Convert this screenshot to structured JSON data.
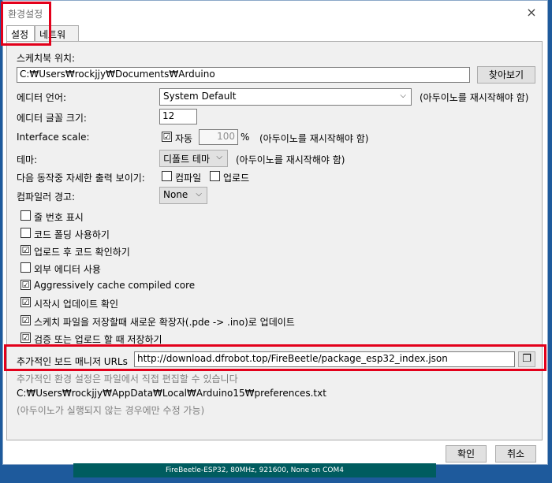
{
  "window": {
    "title": "환경설정",
    "close_icon": "×"
  },
  "tabs": [
    {
      "label": "설정"
    },
    {
      "label": "네트워크"
    }
  ],
  "sketchbook": {
    "label": "스케치북 위치:",
    "path": "C:₩Users₩rockjjy₩Documents₩Arduino",
    "browse_label": "찾아보기"
  },
  "editor_language": {
    "label": "에디터 언어:",
    "value": "System Default",
    "note": "(아두이노를 재시작해야 함)"
  },
  "font_size": {
    "label": "에디터 글꼴 크기:",
    "value": "12"
  },
  "interface_scale": {
    "label": "Interface scale:",
    "auto_label": "자동",
    "value": "100",
    "unit": "%",
    "note": "(아두이노를 재시작해야 함)"
  },
  "theme": {
    "label": "테마:",
    "value": "디폴트 테마",
    "note": "(아두이노를 재시작해야 함)"
  },
  "verbose": {
    "label": "다음 동작중 자세한 출력 보이기:",
    "compile_label": "컴파일",
    "upload_label": "업로드"
  },
  "compiler_warnings": {
    "label": "컴파일러 경고:",
    "value": "None"
  },
  "options": [
    {
      "label": "줄 번호 표시",
      "checked": false
    },
    {
      "label": "코드 폴딩 사용하기",
      "checked": false
    },
    {
      "label": "업로드 후 코드 확인하기",
      "checked": true
    },
    {
      "label": "외부 에디터 사용",
      "checked": false
    },
    {
      "label": "Aggressively cache compiled core",
      "checked": true
    },
    {
      "label": "시작시 업데이트 확인",
      "checked": true
    },
    {
      "label": "스케치 파일을 저장할때 새로운 확장자(.pde -> .ino)로 업데이트",
      "checked": true
    },
    {
      "label": "검증 또는 업로드 할 때 저장하기",
      "checked": true
    }
  ],
  "board_urls": {
    "label": "추가적인 보드 매니저 URLs",
    "value": "http://download.dfrobot.top/FireBeetle/package_esp32_index.json"
  },
  "footer": {
    "more_prefs": "추가적인 환경 설정은 파일에서 직접 편집할 수 있습니다",
    "prefs_path": "C:₩Users₩rockjjy₩AppData₩Local₩Arduino15₩preferences.txt",
    "edit_note": "(아두이노가 실행되지 않는 경우에만 수정 가능)"
  },
  "buttons": {
    "ok": "확인",
    "cancel": "취소"
  },
  "status_bar": "FireBeetle-ESP32, 80MHz, 921600, None on COM4",
  "colors": {
    "highlight": "#e3001b",
    "status_bar_bg": "#005c5f"
  },
  "icons": {
    "check": "☑",
    "dropdown_arrow": "⌵",
    "window_icon": "❐"
  }
}
